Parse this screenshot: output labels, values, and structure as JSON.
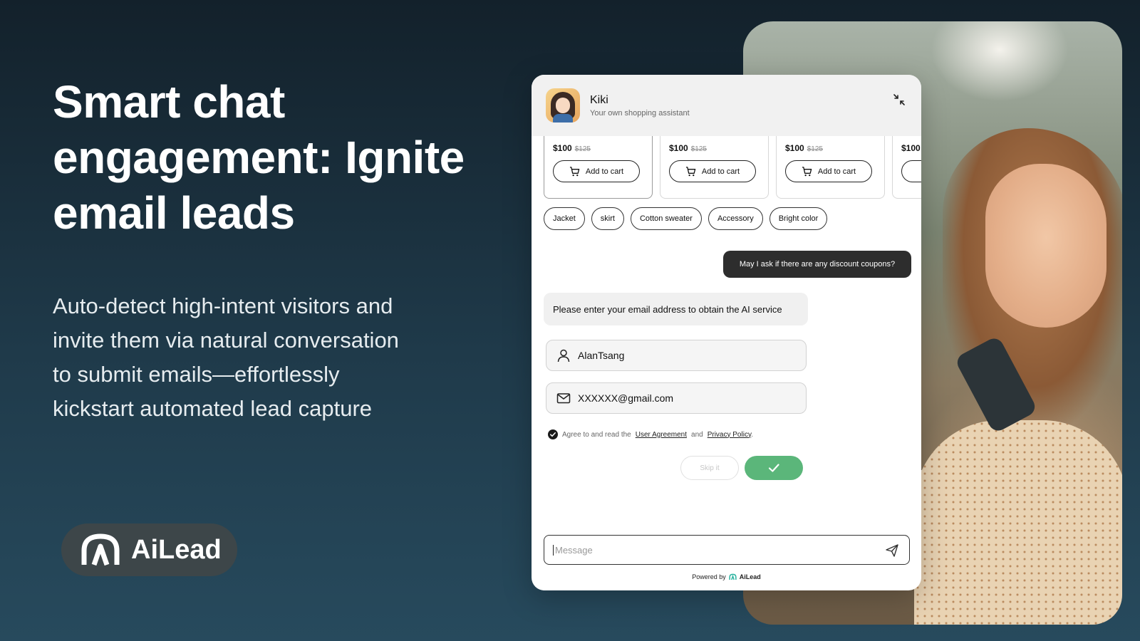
{
  "hero": {
    "headline": "Smart chat\nengagement: Ignite\nemail leads",
    "subtext": "Auto-detect high-intent visitors and\ninvite them via natural conversation\nto submit emails—effortlessly\nkickstart automated lead capture"
  },
  "brand": {
    "name": "AiLead",
    "icon": "ailead-logo-icon"
  },
  "chat": {
    "agent_name": "Kiki",
    "agent_subtitle": "Your own shopping assistant",
    "products": [
      {
        "price": "$100",
        "old_price": "$125",
        "button": "Add to cart"
      },
      {
        "price": "$100",
        "old_price": "$125",
        "button": "Add to cart"
      },
      {
        "price": "$100",
        "old_price": "$125",
        "button": "Add to cart"
      },
      {
        "price": "$100",
        "old_price": "",
        "button": ""
      }
    ],
    "chips": [
      "Jacket",
      "skirt",
      "Cotton sweater",
      "Accessory",
      "Bright color"
    ],
    "user_message": "May I ask if there are any discount coupons?",
    "bot_message": "Please enter your email address to obtain the AI service",
    "name_value": "AlanTsang",
    "email_value": "XXXXXX@gmail.com",
    "agree": {
      "prefix": "Agree to and read the",
      "user_agreement": "User Agreement",
      "and": "and",
      "privacy_policy": "Privacy Policy",
      "suffix": "."
    },
    "skip_label": "Skip it",
    "message_placeholder": "Message",
    "powered_by": "Powered by",
    "powered_brand": "AiLead"
  },
  "colors": {
    "background_top": "#13212b",
    "background_bottom": "#274a5d",
    "confirm_green": "#5bb67a",
    "user_bubble": "#2d2d2d",
    "brand_pill": "#3d4649"
  }
}
